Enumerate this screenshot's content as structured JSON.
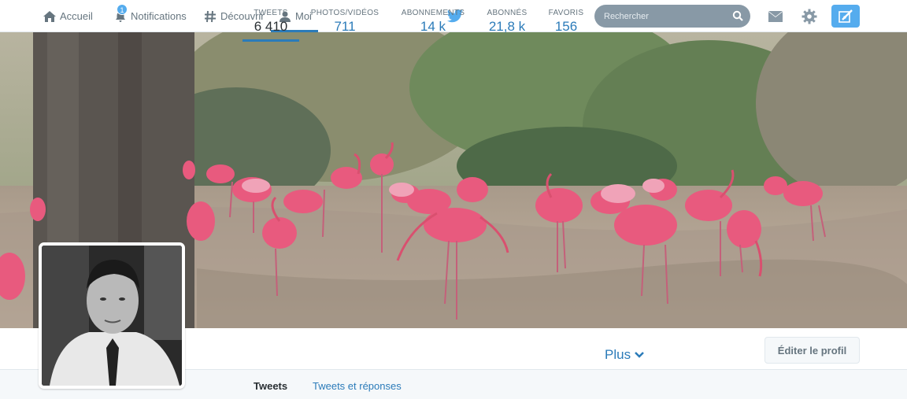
{
  "nav": {
    "home": "Accueil",
    "notifications": "Notifications",
    "notifications_badge": "1",
    "discover": "Découvrir",
    "me": "Moi"
  },
  "search": {
    "placeholder": "Rechercher"
  },
  "stats": [
    {
      "label": "TWEETS",
      "value": "6 410"
    },
    {
      "label": "PHOTOS/VIDÉOS",
      "value": "711"
    },
    {
      "label": "ABONNEMENTS",
      "value": "14 k"
    },
    {
      "label": "ABONNÉS",
      "value": "21,8 k"
    },
    {
      "label": "FAVORIS",
      "value": "156"
    }
  ],
  "more_label": "Plus",
  "edit_profile_label": "Éditer le profil",
  "tabs": [
    {
      "label": "Tweets"
    },
    {
      "label": "Tweets et réponses"
    }
  ],
  "colors": {
    "accent": "#55acee",
    "link": "#2b7bb9",
    "muted": "#66757f"
  }
}
